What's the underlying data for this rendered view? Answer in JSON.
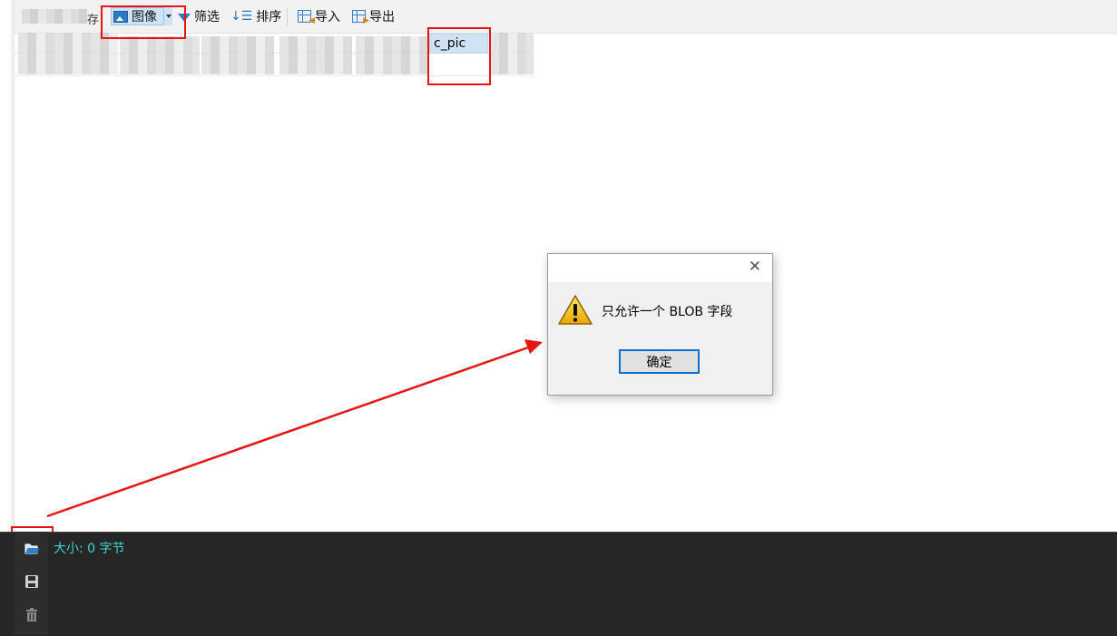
{
  "toolbar": {
    "fragment_char": "存",
    "image_label": "图像",
    "filter_label": "筛选",
    "sort_label": "排序",
    "import_label": "导入",
    "export_label": "导出"
  },
  "table": {
    "visible_column": "c_pic"
  },
  "dialog": {
    "message": "只允许一个 BLOB 字段",
    "ok_label": "确定",
    "close_glyph": "✕"
  },
  "bottom": {
    "size_text": "大小: 0 字节"
  },
  "icons": [
    "image-icon",
    "dropdown-arrow-icon",
    "filter-icon",
    "sort-icon",
    "import-icon",
    "export-icon",
    "warning-icon",
    "close-icon",
    "folder-open-icon",
    "save-icon",
    "trash-icon"
  ],
  "colors": {
    "annotation_red": "#e81414",
    "size_text": "#3fd6d0",
    "panel_bg": "#262626",
    "button_focus": "#0a6fce"
  }
}
